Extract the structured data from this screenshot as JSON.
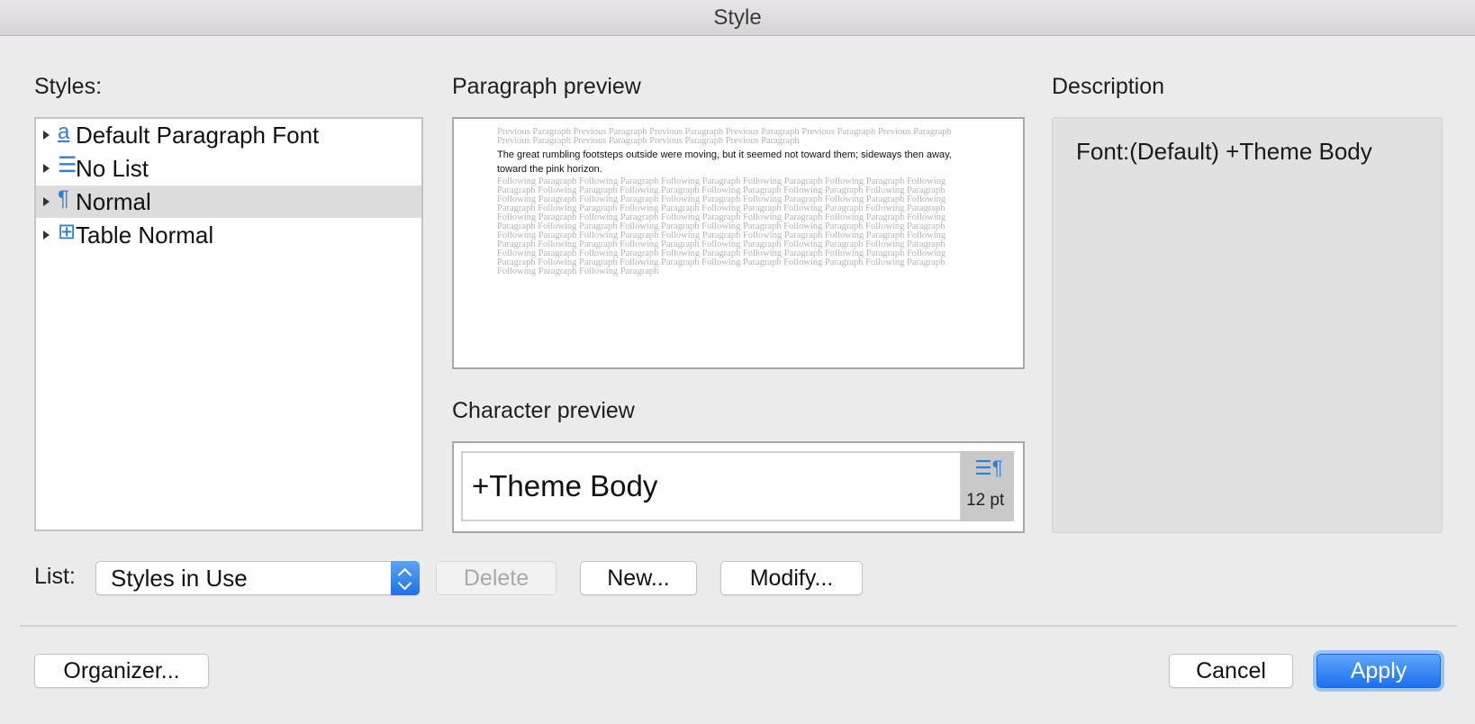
{
  "window": {
    "title": "Style"
  },
  "styles_panel": {
    "label": "Styles:",
    "items": [
      {
        "icon": "a",
        "icon_name": "character-style-icon",
        "label": "Default Paragraph Font",
        "selected": false
      },
      {
        "icon": "☰",
        "icon_name": "list-style-icon",
        "label": "No List",
        "selected": false
      },
      {
        "icon": "¶",
        "icon_name": "paragraph-style-icon",
        "label": "Normal",
        "selected": true
      },
      {
        "icon": "⊞",
        "icon_name": "table-style-icon",
        "label": "Table Normal",
        "selected": false
      }
    ]
  },
  "paragraph_preview": {
    "label": "Paragraph preview",
    "previous_text": "Previous Paragraph Previous Paragraph Previous Paragraph Previous Paragraph Previous Paragraph Previous Paragraph Previous Paragraph Previous Paragraph Previous Paragraph Previous Paragraph",
    "current_text": "The great rumbling footsteps outside were moving, but it seemed not toward them; sideways then away, toward the pink horizon.",
    "following_text": "Following Paragraph Following Paragraph Following Paragraph Following Paragraph Following Paragraph Following Paragraph Following Paragraph Following Paragraph Following Paragraph Following Paragraph Following Paragraph Following Paragraph Following Paragraph Following Paragraph Following Paragraph Following Paragraph Following Paragraph Following Paragraph Following Paragraph Following Paragraph Following Paragraph Following Paragraph Following Paragraph Following Paragraph Following Paragraph Following Paragraph Following Paragraph Following Paragraph Following Paragraph Following Paragraph Following Paragraph Following Paragraph Following Paragraph Following Paragraph Following Paragraph Following Paragraph Following Paragraph Following Paragraph Following Paragraph Following Paragraph Following Paragraph Following Paragraph Following Paragraph Following Paragraph Following Paragraph Following Paragraph Following Paragraph Following Paragraph Following Paragraph Following Paragraph Following Paragraph Following Paragraph Following Paragraph Following Paragraph Following Paragraph Following Paragraph Following Paragraph"
  },
  "character_preview": {
    "label": "Character preview",
    "sample": "+Theme Body",
    "icon": "☰¶",
    "size": "12 pt"
  },
  "description": {
    "label": "Description",
    "text": "Font:(Default) +Theme Body"
  },
  "list_control": {
    "label": "List:",
    "selected": "Styles in Use"
  },
  "buttons": {
    "delete": "Delete",
    "new": "New...",
    "modify": "Modify...",
    "organizer": "Organizer...",
    "cancel": "Cancel",
    "apply": "Apply"
  },
  "colors": {
    "accent": "#2f7fd6",
    "apply_button": "#1c6ff0",
    "selected_row": "#dcdcdc"
  }
}
